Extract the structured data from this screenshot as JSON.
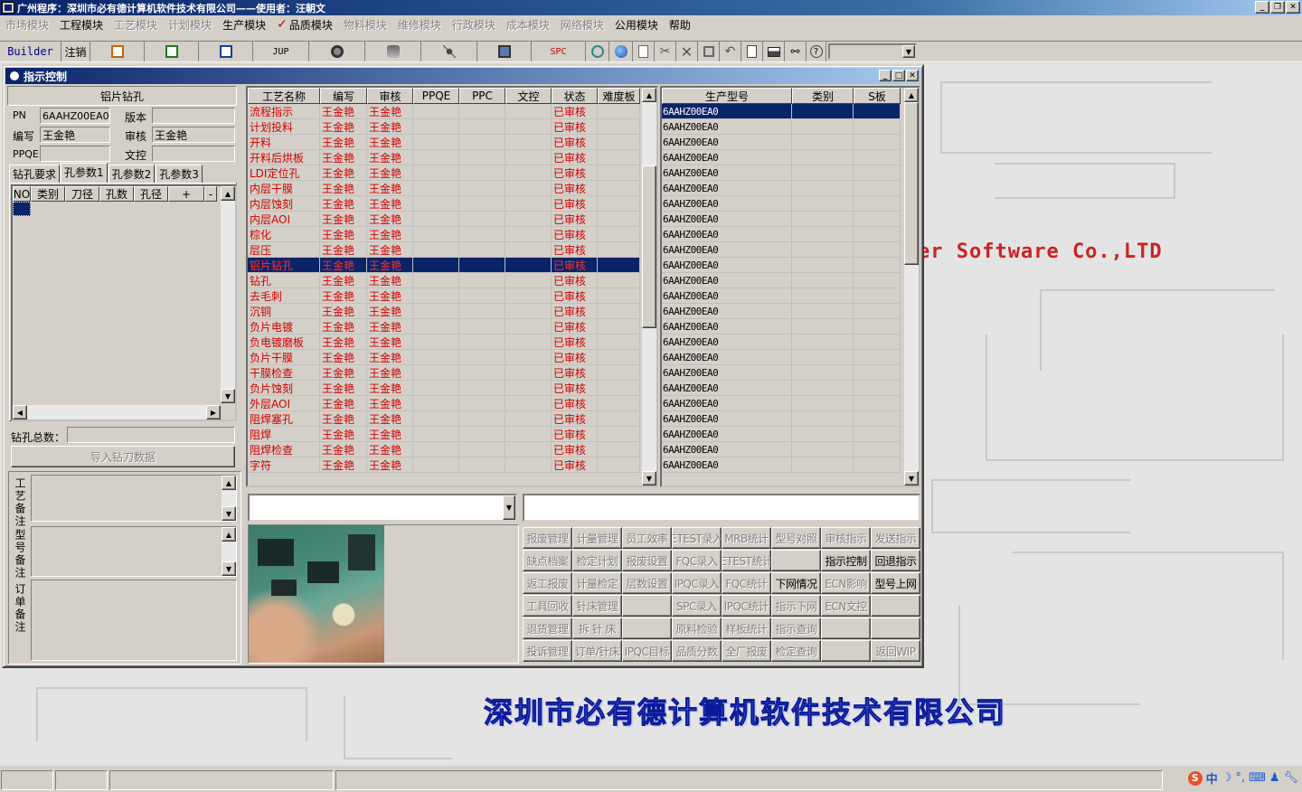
{
  "app": {
    "title": "广州程序：深圳市必有德计算机软件技术有限公司——使用者：汪朝文"
  },
  "menu": [
    {
      "label": "市场模块",
      "state": "dim"
    },
    {
      "label": "工程模块",
      "state": "normal"
    },
    {
      "label": "工艺模块",
      "state": "dim"
    },
    {
      "label": "计划模块",
      "state": "dim"
    },
    {
      "label": "生产模块",
      "state": "normal"
    },
    {
      "label": "品质模块",
      "state": "checked"
    },
    {
      "label": "物料模块",
      "state": "dim"
    },
    {
      "label": "维修模块",
      "state": "dim"
    },
    {
      "label": "行政模块",
      "state": "dim"
    },
    {
      "label": "成本模块",
      "state": "dim"
    },
    {
      "label": "网络模块",
      "state": "dim"
    },
    {
      "label": "公用模块",
      "state": "normal"
    },
    {
      "label": "帮助",
      "state": "normal"
    }
  ],
  "toolbar": {
    "builder": "Builder",
    "logout": "注销",
    "jup": "JUP",
    "spc": "SPC"
  },
  "child": {
    "title": "指示控制",
    "section_title": "铝片钻孔",
    "pn_label": "PN",
    "pn_value": "6AAHZ00EA0",
    "version_label": "版本",
    "version_value": "",
    "editor_label": "编写",
    "editor_value": "王金艳",
    "reviewer_label": "审核",
    "reviewer_value": "王金艳",
    "ppqe_label": "PPQE",
    "ppqe_value": "",
    "doc_label": "文控",
    "doc_value": "",
    "tabs": [
      "钻孔要求",
      "孔参数1",
      "孔参数2",
      "孔参数3"
    ],
    "active_tab": 1,
    "drill_headers": [
      "NO",
      "类别",
      "刀径",
      "孔数",
      "孔径",
      "+",
      "-"
    ],
    "drill_total_label": "钻孔总数：",
    "drill_total_value": "",
    "import_button": "导入钻刀数据",
    "notes": [
      "工艺备注",
      "型号备注",
      "订单备注"
    ]
  },
  "process_grid": {
    "headers": [
      "工艺名称",
      "编写",
      "审核",
      "PPQE",
      "PPC",
      "文控",
      "状态",
      "难度板"
    ],
    "selected_index": 10,
    "rows": [
      {
        "name": "流程指示",
        "writer": "王金艳",
        "reviewer": "王金艳",
        "status": "已审核"
      },
      {
        "name": "计划投料",
        "writer": "王金艳",
        "reviewer": "王金艳",
        "status": "已审核"
      },
      {
        "name": "开料",
        "writer": "王金艳",
        "reviewer": "王金艳",
        "status": "已审核"
      },
      {
        "name": "开料后烘板",
        "writer": "王金艳",
        "reviewer": "王金艳",
        "status": "已审核"
      },
      {
        "name": "LDI定位孔",
        "writer": "王金艳",
        "reviewer": "王金艳",
        "status": "已审核"
      },
      {
        "name": "内层干膜",
        "writer": "王金艳",
        "reviewer": "王金艳",
        "status": "已审核"
      },
      {
        "name": "内层蚀刻",
        "writer": "王金艳",
        "reviewer": "王金艳",
        "status": "已审核"
      },
      {
        "name": "内层AOI",
        "writer": "王金艳",
        "reviewer": "王金艳",
        "status": "已审核"
      },
      {
        "name": "棕化",
        "writer": "王金艳",
        "reviewer": "王金艳",
        "status": "已审核"
      },
      {
        "name": "层压",
        "writer": "王金艳",
        "reviewer": "王金艳",
        "status": "已审核"
      },
      {
        "name": "铝片钻孔",
        "writer": "王金艳",
        "reviewer": "王金艳",
        "status": "已审核"
      },
      {
        "name": "钻孔",
        "writer": "王金艳",
        "reviewer": "王金艳",
        "status": "已审核"
      },
      {
        "name": "去毛刺",
        "writer": "王金艳",
        "reviewer": "王金艳",
        "status": "已审核"
      },
      {
        "name": "沉铜",
        "writer": "王金艳",
        "reviewer": "王金艳",
        "status": "已审核"
      },
      {
        "name": "负片电镀",
        "writer": "王金艳",
        "reviewer": "王金艳",
        "status": "已审核"
      },
      {
        "name": "负电镀磨板",
        "writer": "王金艳",
        "reviewer": "王金艳",
        "status": "已审核"
      },
      {
        "name": "负片干膜",
        "writer": "王金艳",
        "reviewer": "王金艳",
        "status": "已审核"
      },
      {
        "name": "干膜检查",
        "writer": "王金艳",
        "reviewer": "王金艳",
        "status": "已审核"
      },
      {
        "name": "负片蚀刻",
        "writer": "王金艳",
        "reviewer": "王金艳",
        "status": "已审核"
      },
      {
        "name": "外层AOI",
        "writer": "王金艳",
        "reviewer": "王金艳",
        "status": "已审核"
      },
      {
        "name": "阻焊塞孔",
        "writer": "王金艳",
        "reviewer": "王金艳",
        "status": "已审核"
      },
      {
        "name": "阻焊",
        "writer": "王金艳",
        "reviewer": "王金艳",
        "status": "已审核"
      },
      {
        "name": "阻焊检查",
        "writer": "王金艳",
        "reviewer": "王金艳",
        "status": "已审核"
      },
      {
        "name": "字符",
        "writer": "王金艳",
        "reviewer": "王金艳",
        "status": "已审核"
      }
    ]
  },
  "model_grid": {
    "headers": [
      "生产型号",
      "类别",
      "S板"
    ],
    "selected_index": 0,
    "rows": [
      "6AAHZ00EA0",
      "6AAHZ00EA0",
      "6AAHZ00EA0",
      "6AAHZ00EA0",
      "6AAHZ00EA0",
      "6AAHZ00EA0",
      "6AAHZ00EA0",
      "6AAHZ00EA0",
      "6AAHZ00EA0",
      "6AAHZ00EA0",
      "6AAHZ00EA0",
      "6AAHZ00EA0",
      "6AAHZ00EA0",
      "6AAHZ00EA0",
      "6AAHZ00EA0",
      "6AAHZ00EA0",
      "6AAHZ00EA0",
      "6AAHZ00EA0",
      "6AAHZ00EA0",
      "6AAHZ00EA0",
      "6AAHZ00EA0",
      "6AAHZ00EA0",
      "6AAHZ00EA0",
      "6AAHZ00EA0"
    ]
  },
  "function_buttons": [
    [
      {
        "label": "报废管理",
        "dim": true
      },
      {
        "label": "计量管理",
        "dim": true
      },
      {
        "label": "员工效率",
        "dim": true
      },
      {
        "label": "ETEST录入",
        "dim": true
      },
      {
        "label": "MRB统计",
        "dim": true
      },
      {
        "label": "型号对照",
        "dim": true
      },
      {
        "label": "审核指示",
        "dim": true
      },
      {
        "label": "发送指示",
        "dim": true
      }
    ],
    [
      {
        "label": "缺点档案",
        "dim": true
      },
      {
        "label": "检定计划",
        "dim": true
      },
      {
        "label": "报废设置",
        "dim": true
      },
      {
        "label": "FQC录入",
        "dim": true
      },
      {
        "label": "ETEST统计",
        "dim": true
      },
      {
        "label": "",
        "dim": true
      },
      {
        "label": "指示控制",
        "dim": false
      },
      {
        "label": "回退指示",
        "dim": false
      }
    ],
    [
      {
        "label": "返工报废",
        "dim": true
      },
      {
        "label": "计量检定",
        "dim": true
      },
      {
        "label": "层数设置",
        "dim": true
      },
      {
        "label": "IPQC录入",
        "dim": true
      },
      {
        "label": "FQC统计",
        "dim": true
      },
      {
        "label": "下网情况",
        "dim": false
      },
      {
        "label": "ECN影响",
        "dim": true
      },
      {
        "label": "型号上网",
        "dim": false
      }
    ],
    [
      {
        "label": "工具回收",
        "dim": true
      },
      {
        "label": "针床管理",
        "dim": true
      },
      {
        "label": "",
        "dim": true
      },
      {
        "label": "SPC录入",
        "dim": true
      },
      {
        "label": "IPQC统计",
        "dim": true
      },
      {
        "label": "指示下网",
        "dim": true
      },
      {
        "label": "ECN文控",
        "dim": true
      },
      {
        "label": "",
        "dim": true
      }
    ],
    [
      {
        "label": "退货管理",
        "dim": true
      },
      {
        "label": "拆 针 床",
        "dim": true
      },
      {
        "label": "",
        "dim": true
      },
      {
        "label": "原料检验",
        "dim": true
      },
      {
        "label": "样板统计",
        "dim": true
      },
      {
        "label": "指示查询",
        "dim": true
      },
      {
        "label": "",
        "dim": true
      },
      {
        "label": "",
        "dim": true
      }
    ],
    [
      {
        "label": "投诉管理",
        "dim": true
      },
      {
        "label": "订单/针床",
        "dim": true
      },
      {
        "label": "IPQC目标",
        "dim": true
      },
      {
        "label": "品质分数",
        "dim": true
      },
      {
        "label": "全厂报废",
        "dim": true
      },
      {
        "label": "检定查询",
        "dim": true
      },
      {
        "label": "",
        "dim": true
      },
      {
        "label": "返回WIP",
        "dim": true
      }
    ]
  ],
  "background": {
    "brand_en": "er Software Co.,LTD",
    "brand_cn": "深圳市必有德计算机软件技术有限公司"
  },
  "tray": {
    "ime": "中"
  }
}
